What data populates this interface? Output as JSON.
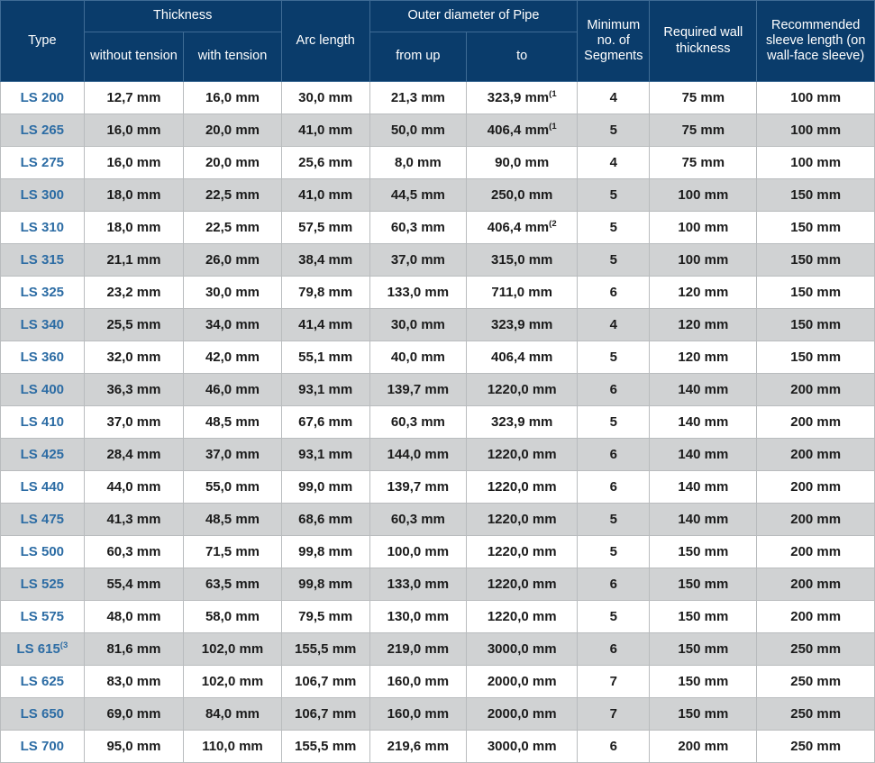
{
  "table": {
    "header": {
      "type": "Type",
      "thickness_group": "Thickness",
      "without_tension": "without tension",
      "with_tension": "with tension",
      "arc_length": "Arc length",
      "outer_diameter_group": "Outer diameter of Pipe",
      "from_up": "from up",
      "to": "to",
      "min_segments": "Minimum no. of Segments",
      "required_wall_thickness": "Required wall thickness",
      "recommended_sleeve_length": "Recommended sleeve length (on wall-face sleeve)"
    },
    "columns": [
      "Type",
      "without tension",
      "with tension",
      "Arc length",
      "from up",
      "to",
      "Minimum no. of Segments",
      "Required wall thickness",
      "Recommended sleeve length (on wall-face sleeve)"
    ],
    "rows": [
      {
        "type": "LS 200",
        "type_note": "",
        "without_tension": "12,7 mm",
        "with_tension": "16,0 mm",
        "arc_length": "30,0 mm",
        "from_up": "21,3 mm",
        "to": "323,9 mm",
        "to_note": "(1",
        "segments": "4",
        "wall_thickness": "75 mm",
        "sleeve_length": "100 mm"
      },
      {
        "type": "LS 265",
        "type_note": "",
        "without_tension": "16,0 mm",
        "with_tension": "20,0 mm",
        "arc_length": "41,0 mm",
        "from_up": "50,0 mm",
        "to": "406,4 mm",
        "to_note": "(1",
        "segments": "5",
        "wall_thickness": "75 mm",
        "sleeve_length": "100 mm"
      },
      {
        "type": "LS 275",
        "type_note": "",
        "without_tension": "16,0 mm",
        "with_tension": "20,0 mm",
        "arc_length": "25,6 mm",
        "from_up": "8,0 mm",
        "to": "90,0 mm",
        "to_note": "",
        "segments": "4",
        "wall_thickness": "75 mm",
        "sleeve_length": "100 mm"
      },
      {
        "type": "LS 300",
        "type_note": "",
        "without_tension": "18,0 mm",
        "with_tension": "22,5 mm",
        "arc_length": "41,0 mm",
        "from_up": "44,5 mm",
        "to": "250,0 mm",
        "to_note": "",
        "segments": "5",
        "wall_thickness": "100 mm",
        "sleeve_length": "150 mm"
      },
      {
        "type": "LS 310",
        "type_note": "",
        "without_tension": "18,0 mm",
        "with_tension": "22,5 mm",
        "arc_length": "57,5 mm",
        "from_up": "60,3 mm",
        "to": "406,4 mm",
        "to_note": "(2",
        "segments": "5",
        "wall_thickness": "100 mm",
        "sleeve_length": "150 mm"
      },
      {
        "type": "LS 315",
        "type_note": "",
        "without_tension": "21,1 mm",
        "with_tension": "26,0 mm",
        "arc_length": "38,4 mm",
        "from_up": "37,0 mm",
        "to": "315,0 mm",
        "to_note": "",
        "segments": "5",
        "wall_thickness": "100 mm",
        "sleeve_length": "150 mm"
      },
      {
        "type": "LS 325",
        "type_note": "",
        "without_tension": "23,2 mm",
        "with_tension": "30,0 mm",
        "arc_length": "79,8 mm",
        "from_up": "133,0 mm",
        "to": "711,0 mm",
        "to_note": "",
        "segments": "6",
        "wall_thickness": "120 mm",
        "sleeve_length": "150 mm"
      },
      {
        "type": "LS 340",
        "type_note": "",
        "without_tension": "25,5 mm",
        "with_tension": "34,0 mm",
        "arc_length": "41,4 mm",
        "from_up": "30,0 mm",
        "to": "323,9 mm",
        "to_note": "",
        "segments": "4",
        "wall_thickness": "120 mm",
        "sleeve_length": "150 mm"
      },
      {
        "type": "LS 360",
        "type_note": "",
        "without_tension": "32,0 mm",
        "with_tension": "42,0 mm",
        "arc_length": "55,1 mm",
        "from_up": "40,0 mm",
        "to": "406,4 mm",
        "to_note": "",
        "segments": "5",
        "wall_thickness": "120 mm",
        "sleeve_length": "150 mm"
      },
      {
        "type": "LS 400",
        "type_note": "",
        "without_tension": "36,3 mm",
        "with_tension": "46,0 mm",
        "arc_length": "93,1 mm",
        "from_up": "139,7 mm",
        "to": "1220,0 mm",
        "to_note": "",
        "segments": "6",
        "wall_thickness": "140 mm",
        "sleeve_length": "200 mm"
      },
      {
        "type": "LS 410",
        "type_note": "",
        "without_tension": "37,0 mm",
        "with_tension": "48,5 mm",
        "arc_length": "67,6 mm",
        "from_up": "60,3 mm",
        "to": "323,9 mm",
        "to_note": "",
        "segments": "5",
        "wall_thickness": "140 mm",
        "sleeve_length": "200 mm"
      },
      {
        "type": "LS 425",
        "type_note": "",
        "without_tension": "28,4 mm",
        "with_tension": "37,0 mm",
        "arc_length": "93,1 mm",
        "from_up": "144,0 mm",
        "to": "1220,0 mm",
        "to_note": "",
        "segments": "6",
        "wall_thickness": "140 mm",
        "sleeve_length": "200 mm"
      },
      {
        "type": "LS 440",
        "type_note": "",
        "without_tension": "44,0 mm",
        "with_tension": "55,0 mm",
        "arc_length": "99,0 mm",
        "from_up": "139,7 mm",
        "to": "1220,0 mm",
        "to_note": "",
        "segments": "6",
        "wall_thickness": "140 mm",
        "sleeve_length": "200 mm"
      },
      {
        "type": "LS 475",
        "type_note": "",
        "without_tension": "41,3 mm",
        "with_tension": "48,5 mm",
        "arc_length": "68,6 mm",
        "from_up": "60,3 mm",
        "to": "1220,0 mm",
        "to_note": "",
        "segments": "5",
        "wall_thickness": "140 mm",
        "sleeve_length": "200 mm"
      },
      {
        "type": "LS 500",
        "type_note": "",
        "without_tension": "60,3 mm",
        "with_tension": "71,5 mm",
        "arc_length": "99,8 mm",
        "from_up": "100,0 mm",
        "to": "1220,0 mm",
        "to_note": "",
        "segments": "5",
        "wall_thickness": "150 mm",
        "sleeve_length": "200 mm"
      },
      {
        "type": "LS 525",
        "type_note": "",
        "without_tension": "55,4 mm",
        "with_tension": "63,5 mm",
        "arc_length": "99,8 mm",
        "from_up": "133,0 mm",
        "to": "1220,0 mm",
        "to_note": "",
        "segments": "6",
        "wall_thickness": "150 mm",
        "sleeve_length": "200 mm"
      },
      {
        "type": "LS 575",
        "type_note": "",
        "without_tension": "48,0 mm",
        "with_tension": "58,0 mm",
        "arc_length": "79,5 mm",
        "from_up": "130,0 mm",
        "to": "1220,0 mm",
        "to_note": "",
        "segments": "5",
        "wall_thickness": "150 mm",
        "sleeve_length": "200 mm"
      },
      {
        "type": "LS 615",
        "type_note": "(3",
        "without_tension": "81,6 mm",
        "with_tension": "102,0 mm",
        "arc_length": "155,5 mm",
        "from_up": "219,0 mm",
        "to": "3000,0 mm",
        "to_note": "",
        "segments": "6",
        "wall_thickness": "150 mm",
        "sleeve_length": "250 mm"
      },
      {
        "type": "LS 625",
        "type_note": "",
        "without_tension": "83,0 mm",
        "with_tension": "102,0 mm",
        "arc_length": "106,7 mm",
        "from_up": "160,0 mm",
        "to": "2000,0 mm",
        "to_note": "",
        "segments": "7",
        "wall_thickness": "150 mm",
        "sleeve_length": "250 mm"
      },
      {
        "type": "LS 650",
        "type_note": "",
        "without_tension": "69,0 mm",
        "with_tension": "84,0 mm",
        "arc_length": "106,7 mm",
        "from_up": "160,0 mm",
        "to": "2000,0 mm",
        "to_note": "",
        "segments": "7",
        "wall_thickness": "150 mm",
        "sleeve_length": "250 mm"
      },
      {
        "type": "LS 700",
        "type_note": "",
        "without_tension": "95,0 mm",
        "with_tension": "110,0 mm",
        "arc_length": "155,5 mm",
        "from_up": "219,6 mm",
        "to": "3000,0 mm",
        "to_note": "",
        "segments": "6",
        "wall_thickness": "200 mm",
        "sleeve_length": "250 mm"
      }
    ]
  },
  "colors": {
    "header_background": "#0a3c6b",
    "header_text": "#ffffff",
    "type_text": "#2c6ca4",
    "row_alt_background": "#d0d2d3",
    "row_background": "#ffffff",
    "border": "#b9bcbe",
    "body_text": "#1b1b1b"
  }
}
